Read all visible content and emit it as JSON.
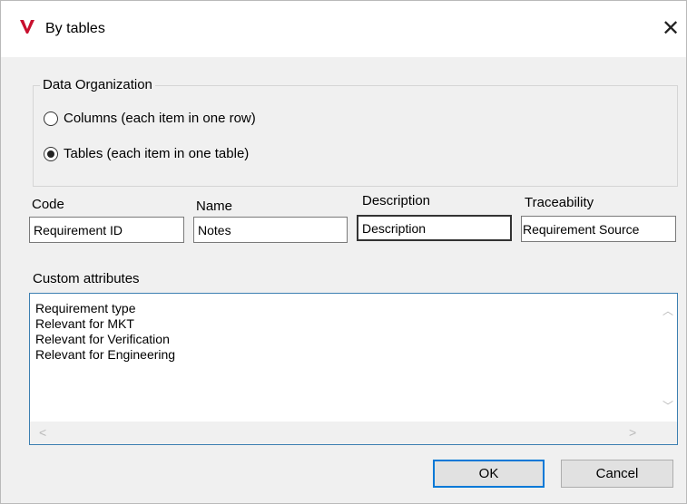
{
  "window": {
    "title": "By tables",
    "close_glyph": "✕",
    "logo_color": "#c8102e"
  },
  "data_organization": {
    "title": "Data Organization",
    "options": [
      {
        "label": "Columns (each  item in one row)",
        "selected": false
      },
      {
        "label": "Tables (each item in one table)",
        "selected": true
      }
    ]
  },
  "fields": {
    "code": {
      "label": "Code",
      "value": "Requirement ID"
    },
    "name": {
      "label": "Name",
      "value": "Notes"
    },
    "description": {
      "label": "Description",
      "value": "Description"
    },
    "traceability": {
      "label": "Traceability",
      "value": "Requirement Source"
    }
  },
  "custom_attributes": {
    "label": "Custom attributes",
    "items": [
      "Requirement type",
      "Relevant for MKT",
      "Relevant for Verification",
      "Relevant for Engineering"
    ]
  },
  "buttons": {
    "ok": "OK",
    "cancel": "Cancel"
  }
}
